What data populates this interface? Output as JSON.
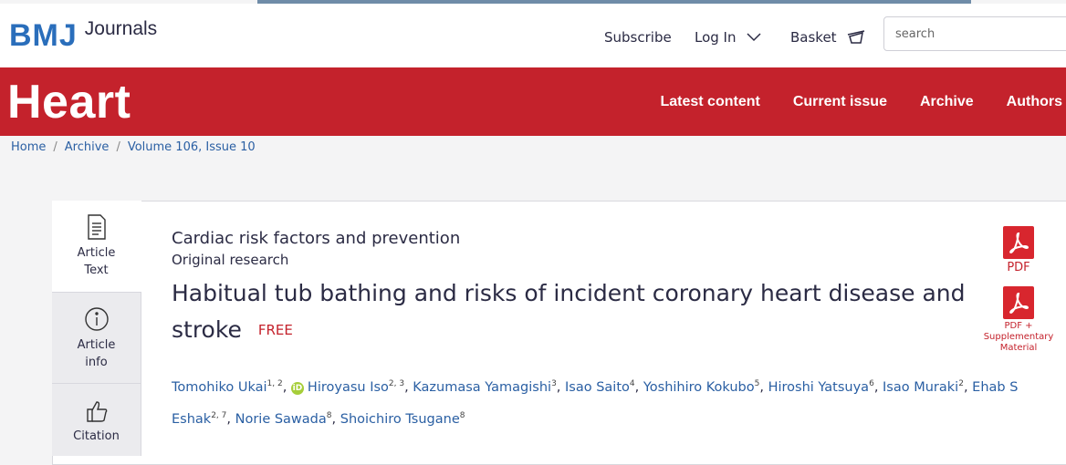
{
  "header": {
    "brand": "BMJ",
    "brand_sub": "Journals",
    "subscribe": "Subscribe",
    "login": "Log In",
    "basket": "Basket",
    "search_placeholder": "search"
  },
  "journal": {
    "title": "Heart",
    "nav": [
      "Latest content",
      "Current issue",
      "Archive",
      "Authors"
    ]
  },
  "breadcrumb": [
    "Home",
    "Archive",
    "Volume 106, Issue 10"
  ],
  "side_tabs": [
    {
      "line1": "Article",
      "line2": "Text",
      "icon": "document-icon"
    },
    {
      "line1": "Article",
      "line2": "info",
      "icon": "info-icon"
    },
    {
      "line1": "Citation",
      "line2": "",
      "icon": "thumbs-up-icon"
    }
  ],
  "article": {
    "subject": "Cardiac risk factors and prevention",
    "type": "Original research",
    "title": "Habitual tub bathing and risks of incident coronary heart disease and stroke",
    "free": "FREE",
    "authors": [
      {
        "name": "Tomohiko Ukai",
        "aff": "1, 2",
        "orcid": false
      },
      {
        "name": "Hiroyasu Iso",
        "aff": "2, 3",
        "orcid": true
      },
      {
        "name": "Kazumasa Yamagishi",
        "aff": "3",
        "orcid": false
      },
      {
        "name": "Isao Saito",
        "aff": "4",
        "orcid": false
      },
      {
        "name": "Yoshihiro Kokubo",
        "aff": "5",
        "orcid": false
      },
      {
        "name": "Hiroshi Yatsuya",
        "aff": "6",
        "orcid": false
      },
      {
        "name": "Isao Muraki",
        "aff": "2",
        "orcid": false
      },
      {
        "name": "Ehab S Eshak",
        "aff": "2, 7",
        "orcid": false
      },
      {
        "name": "Norie Sawada",
        "aff": "8",
        "orcid": false
      },
      {
        "name": "Shoichiro Tsugane",
        "aff": "8",
        "orcid": false
      }
    ]
  },
  "downloads": {
    "pdf": "PDF",
    "pdf_supp": "PDF + Supplementary Material"
  },
  "colors": {
    "journal_red": "#c4222c",
    "bmj_blue": "#2a6ebb",
    "link_blue": "#2a5fa3"
  }
}
